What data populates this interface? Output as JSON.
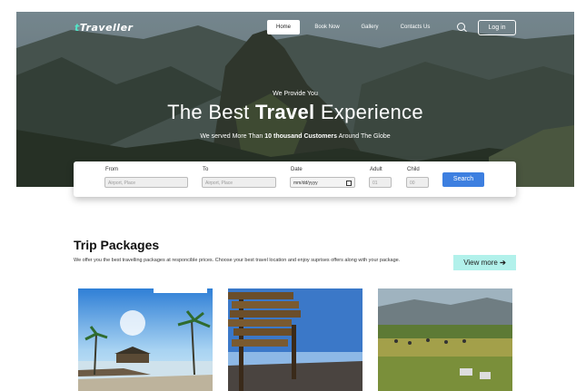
{
  "nav": {
    "brand_accent": "t",
    "brand_rest": "Traveller",
    "items": [
      "Home",
      "Book Now",
      "Gallery",
      "Contacts Us"
    ],
    "login": "Log in",
    "search_icon": "search-icon"
  },
  "hero": {
    "pre": "We Provide You",
    "headline_a": "The Best",
    "headline_b": "Travel",
    "headline_c": "Experience",
    "sub_a": "We served More Than",
    "sub_b": "10 thousand Customers",
    "sub_c": "Around The Globe"
  },
  "form": {
    "from_label": "From",
    "from_placeholder": "Airport, Place",
    "to_label": "To",
    "to_placeholder": "Airport, Place",
    "date_label": "Date",
    "date_value": "mm/dd/yyyy",
    "adult_label": "Adult",
    "adult_placeholder": "01",
    "child_label": "Child",
    "child_placeholder": "00",
    "search_button": "Search"
  },
  "packages": {
    "title": "Trip Packages",
    "description": "We offer you the best travelling packages at responcible prices. Choose your best travel location and enjoy suprises offers along with your package.",
    "view_more": "View more",
    "view_more_icon": "arrow-right-icon"
  },
  "colors": {
    "accent": "#53e6c8",
    "button": "#3d7fe0",
    "view_more_bg": "#b2f1eb"
  }
}
